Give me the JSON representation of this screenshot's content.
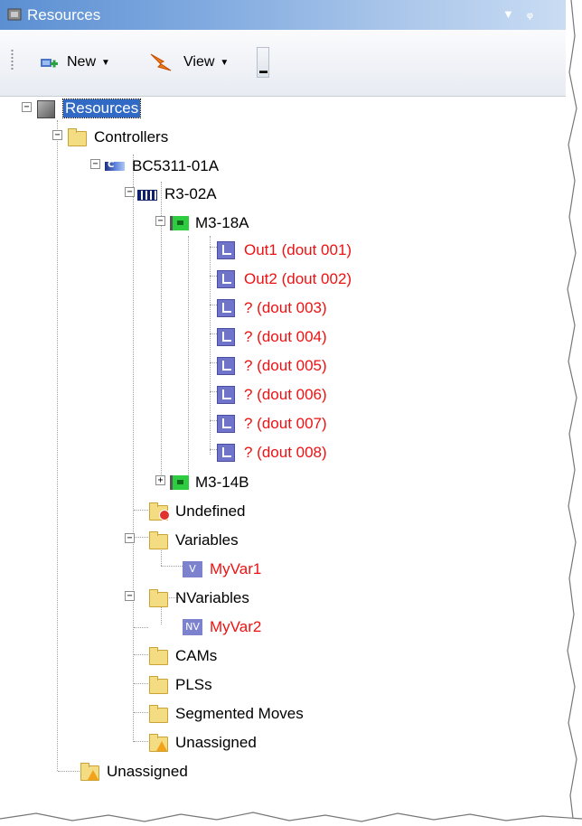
{
  "panel": {
    "title": "Resources",
    "title_icon": "resources-box-icon",
    "controls": [
      "dropdown-arrow-icon",
      "pin-icon"
    ]
  },
  "toolbar": {
    "new_label": "New",
    "view_label": "View",
    "new_icon": "new-resource-icon",
    "view_icon": "view-arrow-icon"
  },
  "tree": {
    "root": "Resources",
    "controllers": "Controllers",
    "controller": "BC5311-01A",
    "rack": "R3-02A",
    "module1": "M3-18A",
    "outputs": [
      "Out1 (dout 001)",
      "Out2 (dout 002)",
      "? (dout 003)",
      "? (dout 004)",
      "? (dout 005)",
      "? (dout 006)",
      "? (dout 007)",
      "? (dout 008)"
    ],
    "module2": "M3-14B",
    "undefined": "Undefined",
    "variables": "Variables",
    "var1": "MyVar1",
    "var1_tag": "V",
    "nvariables": "NVariables",
    "var2": "MyVar2",
    "var2_tag": "NV",
    "cams": "CAMs",
    "plss": "PLSs",
    "segmented": "Segmented Moves",
    "unassigned_inner": "Unassigned",
    "unassigned_outer": "Unassigned"
  },
  "colors": {
    "unassigned_resource": "#ee1111",
    "selection": "#316ac5"
  }
}
